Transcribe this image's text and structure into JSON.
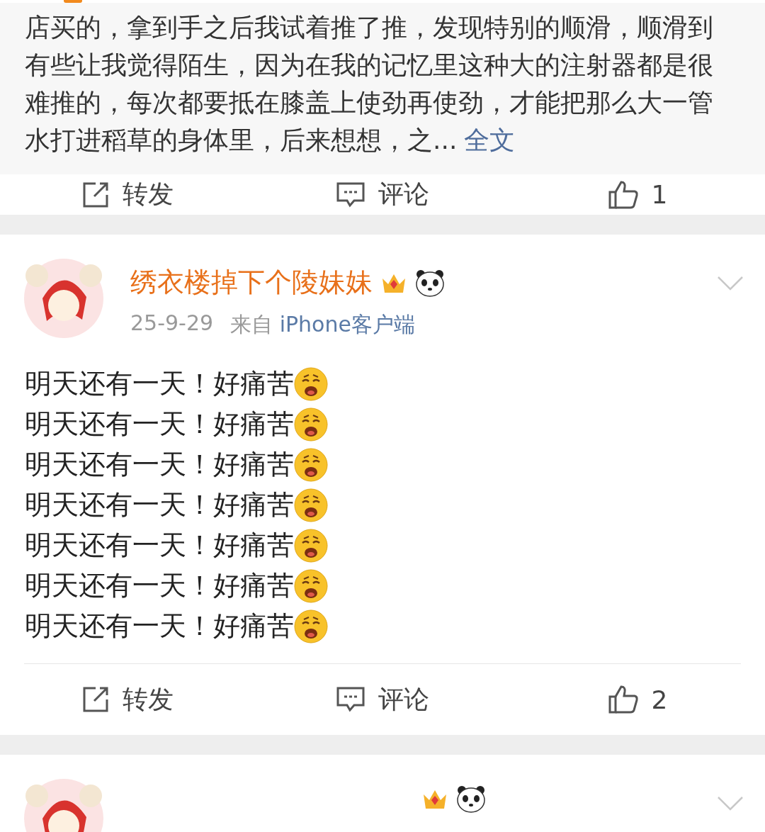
{
  "repost": {
    "lines": [
      "店买的，拿到手之后我试着推了推，发现特别的顺滑，顺滑到",
      "有些让我觉得陌生，因为在我的记忆里这种大的注射器都是很",
      "难推的，每次都要抵在膝盖上使劲再使劲，才能把那么大一管",
      "水打进稻草的身体里，后来想想，之..."
    ],
    "more_link": "全文"
  },
  "repost_actions": {
    "share": "转发",
    "comment": "评论",
    "likes": "1"
  },
  "post": {
    "author": "绣衣楼掉下个陵妹妹",
    "date": "25-9-29",
    "source_prefix": "来自",
    "source": "iPhone客户端",
    "lines": [
      "明天还有一天！好痛苦",
      "明天还有一天！好痛苦",
      "明天还有一天！好痛苦",
      "明天还有一天！好痛苦",
      "明天还有一天！好痛苦",
      "明天还有一天！好痛苦",
      "明天还有一天！好痛苦"
    ],
    "actions": {
      "share": "转发",
      "comment": "评论",
      "likes": "2"
    }
  }
}
